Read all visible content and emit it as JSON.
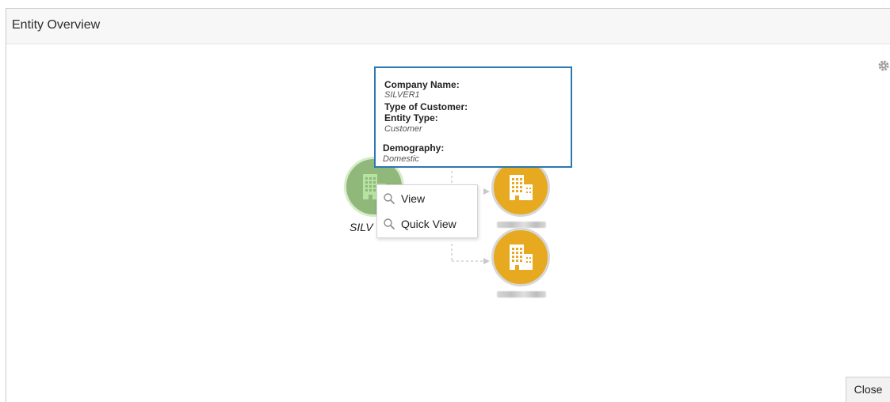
{
  "window": {
    "title": "Entity Overview"
  },
  "toolbar": {
    "settings_icon": "gear-icon"
  },
  "tooltip": {
    "company_name_label": "Company Name:",
    "company_name_value": "SILVER1",
    "customer_type_label": "Type of Customer:",
    "entity_type_label": "Entity Type:",
    "entity_type_value": "Customer",
    "demography_label": "Demography:",
    "demography_value": "Domestic"
  },
  "nodes": {
    "main": {
      "label_visible": "SILV",
      "icon": "building-icon",
      "color": "#8fb87a"
    },
    "children": [
      {
        "icon": "building-icon",
        "color": "#e6a920"
      },
      {
        "icon": "building-icon",
        "color": "#e6a920"
      }
    ]
  },
  "context_menu": {
    "items": [
      {
        "label": "View",
        "icon": "magnifier-icon"
      },
      {
        "label": "Quick View",
        "icon": "magnifier-icon"
      }
    ]
  },
  "footer": {
    "close_label": "Close"
  }
}
